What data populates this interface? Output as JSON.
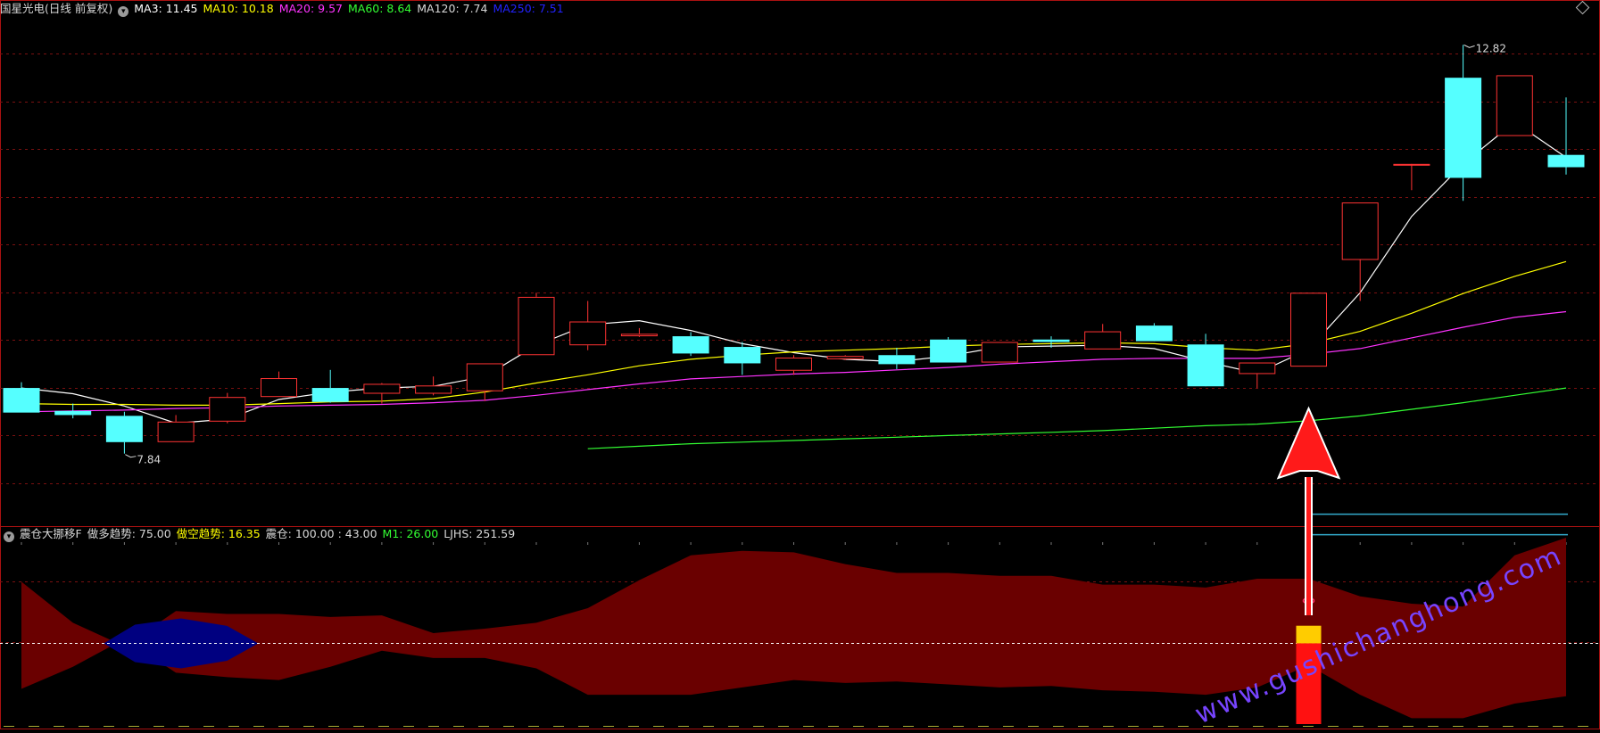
{
  "header": {
    "stock_name": "国星光电(日线 前复权)",
    "indicators": [
      {
        "label": "MA3: 11.45",
        "color": "#ffffff"
      },
      {
        "label": "MA10: 10.18",
        "color": "#ffff00"
      },
      {
        "label": "MA20: 9.57",
        "color": "#ff33ff"
      },
      {
        "label": "MA60: 8.64",
        "color": "#33ff33"
      },
      {
        "label": "MA120: 7.74",
        "color": "#d8d8d8"
      },
      {
        "label": "MA250: 7.51",
        "color": "#2222ff"
      }
    ]
  },
  "sub_header": {
    "indicator_name": "震仓大挪移F",
    "items": [
      {
        "label": "做多趋势: 75.00",
        "color": "#d8d8d8"
      },
      {
        "label": "做空趋势: 16.35",
        "color": "#ffff00"
      },
      {
        "label": "震仓: 100.00 : 43.00",
        "color": "#d8d8d8"
      },
      {
        "label": "M1: 26.00",
        "color": "#33ff33"
      },
      {
        "label": "LJHS: 251.59",
        "color": "#d8d8d8"
      }
    ]
  },
  "annotations": {
    "high_label": "12.82",
    "low_label": "7.84",
    "watermark": "www.gushichanghong.com"
  },
  "colors": {
    "up": "#ff3333",
    "down": "#55ffff",
    "grid": "#7a1010",
    "border": "#aa1111",
    "band": "#6a0000",
    "band_neg": "#000080",
    "arrow": "#ff1a1a",
    "watermark": "#7744ff"
  },
  "chart_data": [
    {
      "type": "candlestick",
      "y_scale": [
        7.0,
        13.15
      ],
      "candles": [
        {
          "o": 8.64,
          "h": 8.71,
          "l": 8.34,
          "c": 8.34
        },
        {
          "o": 8.36,
          "h": 8.45,
          "l": 8.27,
          "c": 8.31
        },
        {
          "o": 8.3,
          "h": 8.35,
          "l": 7.84,
          "c": 7.98
        },
        {
          "o": 7.98,
          "h": 8.31,
          "l": 7.98,
          "c": 8.23
        },
        {
          "o": 8.23,
          "h": 8.58,
          "l": 8.21,
          "c": 8.53
        },
        {
          "o": 8.53,
          "h": 8.84,
          "l": 8.53,
          "c": 8.76
        },
        {
          "o": 8.64,
          "h": 8.86,
          "l": 8.46,
          "c": 8.47
        },
        {
          "o": 8.57,
          "h": 8.7,
          "l": 8.45,
          "c": 8.69
        },
        {
          "o": 8.57,
          "h": 8.78,
          "l": 8.55,
          "c": 8.67
        },
        {
          "o": 8.6,
          "h": 8.94,
          "l": 8.48,
          "c": 8.94
        },
        {
          "o": 9.04,
          "h": 9.8,
          "l": 9.04,
          "c": 9.75
        },
        {
          "o": 9.16,
          "h": 9.7,
          "l": 9.1,
          "c": 9.45
        },
        {
          "o": 9.27,
          "h": 9.37,
          "l": 9.26,
          "c": 9.3
        },
        {
          "o": 9.27,
          "h": 9.32,
          "l": 9.03,
          "c": 9.06
        },
        {
          "o": 9.14,
          "h": 9.2,
          "l": 8.8,
          "c": 8.94
        },
        {
          "o": 8.85,
          "h": 9.04,
          "l": 8.8,
          "c": 9.01
        },
        {
          "o": 8.99,
          "h": 9.04,
          "l": 8.98,
          "c": 9.03
        },
        {
          "o": 9.04,
          "h": 9.13,
          "l": 8.87,
          "c": 8.93
        },
        {
          "o": 9.23,
          "h": 9.26,
          "l": 8.95,
          "c": 8.95
        },
        {
          "o": 8.95,
          "h": 9.2,
          "l": 8.95,
          "c": 9.2
        },
        {
          "o": 9.23,
          "h": 9.27,
          "l": 9.13,
          "c": 9.2
        },
        {
          "o": 9.11,
          "h": 9.42,
          "l": 9.11,
          "c": 9.33
        },
        {
          "o": 9.4,
          "h": 9.43,
          "l": 9.22,
          "c": 9.21
        },
        {
          "o": 9.17,
          "h": 9.3,
          "l": 8.78,
          "c": 8.66
        },
        {
          "o": 8.81,
          "h": 8.95,
          "l": 8.64,
          "c": 8.95
        },
        {
          "o": 8.9,
          "h": 9.8,
          "l": 8.9,
          "c": 9.8
        },
        {
          "o": 10.2,
          "h": 10.9,
          "l": 9.7,
          "c": 10.9
        },
        {
          "o": 11.37,
          "h": 11.37,
          "l": 11.05,
          "c": 11.37
        },
        {
          "o": 12.42,
          "h": 12.82,
          "l": 10.92,
          "c": 11.2
        },
        {
          "o": 11.71,
          "h": 12.45,
          "l": 11.71,
          "c": 12.45
        },
        {
          "o": 11.48,
          "h": 12.18,
          "l": 11.24,
          "c": 11.33
        }
      ],
      "series": [
        {
          "values": [
            8.64,
            8.57,
            8.42,
            8.21,
            8.26,
            8.5,
            8.59,
            8.64,
            8.66,
            8.78,
            9.16,
            9.41,
            9.46,
            9.34,
            9.18,
            9.07,
            8.99,
            8.96,
            9.03,
            9.14,
            9.15,
            9.16,
            9.12,
            8.96,
            8.82,
            9.11,
            9.8,
            10.73,
            11.37,
            11.88,
            11.45
          ]
        },
        {
          "values": [
            8.45,
            8.44,
            8.44,
            8.43,
            8.43,
            8.45,
            8.47,
            8.48,
            8.51,
            8.59,
            8.7,
            8.8,
            8.91,
            8.99,
            9.04,
            9.08,
            9.1,
            9.12,
            9.15,
            9.17,
            9.18,
            9.19,
            9.18,
            9.13,
            9.1,
            9.18,
            9.33,
            9.55,
            9.79,
            10.0,
            10.18
          ]
        },
        {
          "values": [
            8.35,
            8.36,
            8.37,
            8.39,
            8.4,
            8.42,
            8.43,
            8.44,
            8.46,
            8.49,
            8.55,
            8.62,
            8.69,
            8.75,
            8.78,
            8.81,
            8.83,
            8.86,
            8.89,
            8.93,
            8.96,
            8.99,
            9.0,
            9.0,
            9.0,
            9.05,
            9.12,
            9.25,
            9.38,
            9.5,
            9.57
          ]
        },
        {
          "values": [
            null,
            null,
            null,
            null,
            null,
            null,
            null,
            null,
            null,
            null,
            null,
            7.9,
            7.93,
            7.96,
            7.98,
            8.0,
            8.02,
            8.04,
            8.06,
            8.08,
            8.1,
            8.12,
            8.15,
            8.18,
            8.2,
            8.24,
            8.3,
            8.38,
            8.46,
            8.55,
            8.64
          ]
        }
      ]
    },
    {
      "type": "area",
      "y_scale": [
        -0.55,
        0.75
      ],
      "band": {
        "upper": [
          0.42,
          0.14,
          -0.02,
          0.22,
          0.2,
          0.2,
          0.18,
          0.19,
          0.07,
          0.1,
          0.14,
          0.24,
          0.43,
          0.6,
          0.63,
          0.62,
          0.54,
          0.48,
          0.48,
          0.46,
          0.46,
          0.4,
          0.4,
          0.38,
          0.44,
          0.44,
          0.32,
          0.27,
          0.25,
          0.6,
          0.72
        ],
        "lower": [
          -0.31,
          -0.16,
          0.03,
          -0.2,
          -0.23,
          -0.25,
          -0.16,
          -0.05,
          -0.1,
          -0.1,
          -0.17,
          -0.35,
          -0.35,
          -0.35,
          -0.3,
          -0.25,
          -0.27,
          -0.26,
          -0.28,
          -0.3,
          -0.29,
          -0.32,
          -0.33,
          -0.35,
          -0.3,
          -0.15,
          -0.35,
          -0.51,
          -0.51,
          -0.41,
          -0.36
        ]
      },
      "blue_segment": {
        "start": 1.6,
        "end": 4.6,
        "upper": 0.17,
        "lower": -0.17
      },
      "bar": {
        "index": 25,
        "yellow": [
          0.0,
          0.12
        ],
        "red": [
          -0.55,
          0.0
        ]
      },
      "cyan_lines": [
        0.88,
        0.74
      ],
      "baseline": 0
    }
  ]
}
